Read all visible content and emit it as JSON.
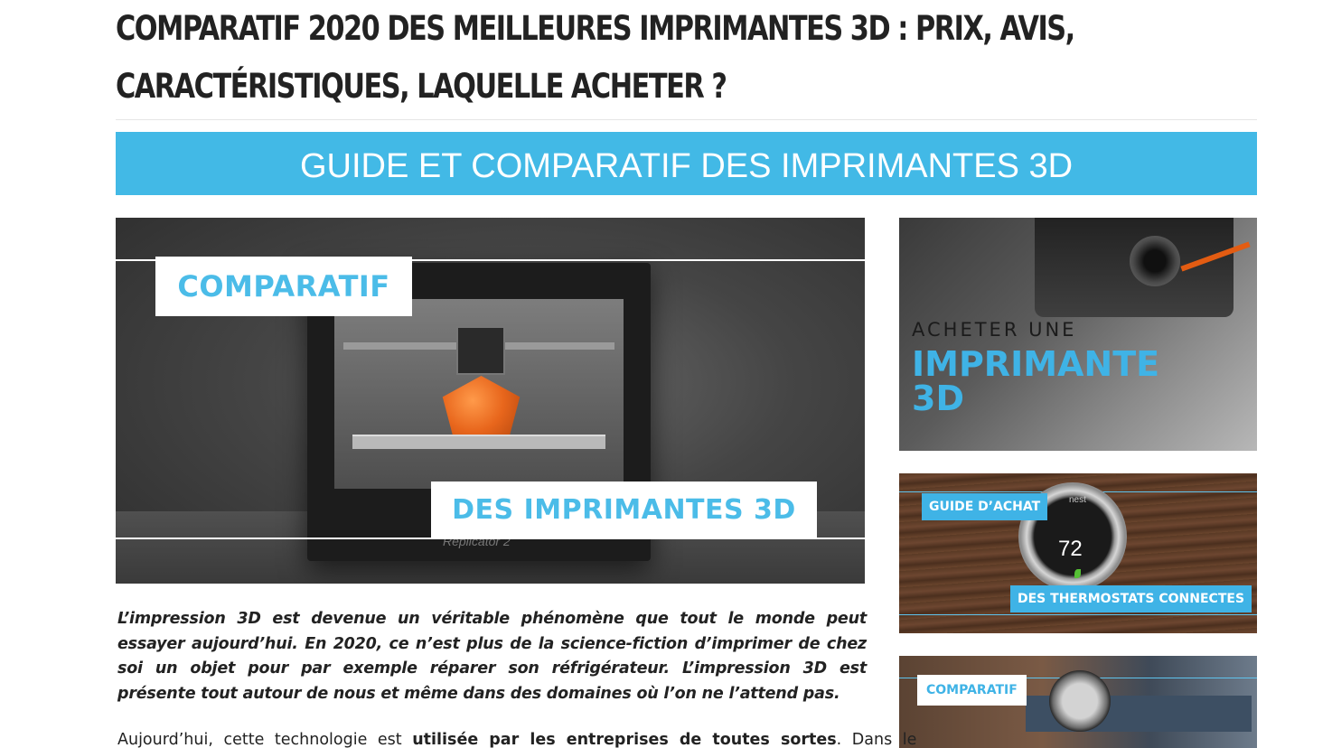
{
  "article": {
    "title": "Comparatif 2020 des meilleures imprimantes 3D : prix, avis, caractéristiques, laquelle acheter ?",
    "banner": "GUIDE ET COMPARATIF DES IMPRIMANTES 3D",
    "hero": {
      "top_label": "COMPARATIF",
      "bottom_label": "DES IMPRIMANTES 3D",
      "printer_text": "Replicator 2"
    },
    "intro": "L’impression 3D est devenue un véritable phénomène que tout le monde peut essayer aujourd’hui. En 2020, ce n’est plus de la science-fiction d’imprimer de chez soi un objet pour par exemple réparer son réfrigérateur. L’impression 3D est présente tout autour de nous et même dans des domaines où l’on ne l’attend pas.",
    "para_start": "Aujourd’hui, cette technologie est ",
    "para_bold": "utilisée par les entreprises de toutes sortes",
    "para_end": ". Dans le"
  },
  "sidebar": {
    "cards": [
      {
        "line1": "ACHETER UNE",
        "line2": "IMPRIMANTE",
        "line3": "3D"
      },
      {
        "tag_top": "GUIDE D’ACHAT",
        "tag_bottom": "DES THERMOSTATS CONNECTES",
        "display_value": "72",
        "brand": "nest"
      },
      {
        "tag_top": "COMPARATIF"
      }
    ]
  },
  "colors": {
    "accent": "#42b9e6",
    "title": "#222222",
    "text": "#222222"
  }
}
